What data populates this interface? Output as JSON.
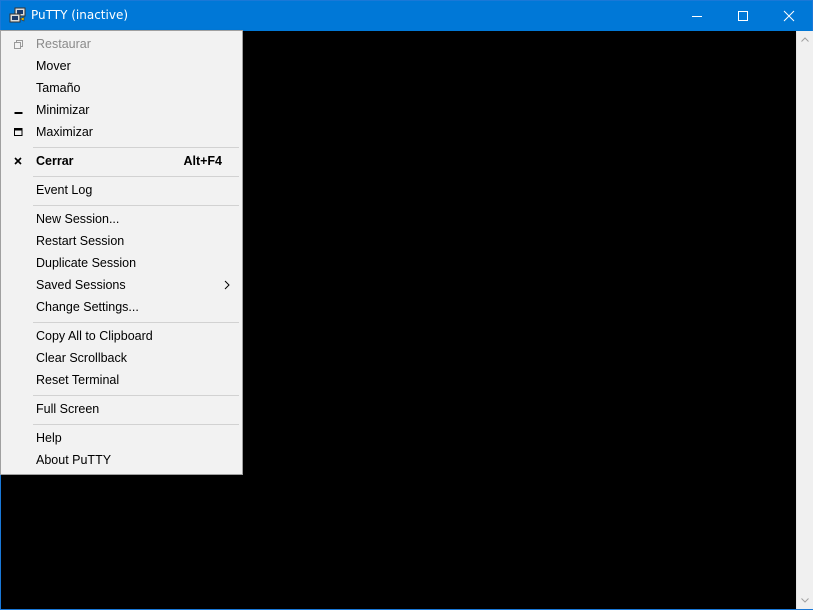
{
  "window": {
    "title": "PuTTY (inactive)",
    "accent_color": "#0078d7",
    "terminal_bg": "#000000",
    "app_icon": "putty-icon",
    "buttons": [
      "minimize-icon",
      "maximize-icon",
      "close-icon"
    ]
  },
  "menu": {
    "items": [
      {
        "label": "Restaurar",
        "icon": "restore-icon",
        "disabled": true
      },
      {
        "label": "Mover"
      },
      {
        "label": "Tamaño"
      },
      {
        "label": "Minimizar",
        "icon": "minimize-icon"
      },
      {
        "label": "Maximizar",
        "icon": "maximize-icon"
      },
      {
        "label": "Cerrar",
        "icon": "close-x-icon",
        "bold": true,
        "shortcut": "Alt+F4"
      },
      {
        "label": "Event Log"
      },
      {
        "label": "New Session..."
      },
      {
        "label": "Restart Session"
      },
      {
        "label": "Duplicate Session"
      },
      {
        "label": "Saved Sessions",
        "submenu": true
      },
      {
        "label": "Change Settings..."
      },
      {
        "label": "Copy All to Clipboard"
      },
      {
        "label": "Clear Scrollback"
      },
      {
        "label": "Reset Terminal"
      },
      {
        "label": "Full Screen"
      },
      {
        "label": "Help"
      },
      {
        "label": "About PuTTY"
      }
    ]
  }
}
